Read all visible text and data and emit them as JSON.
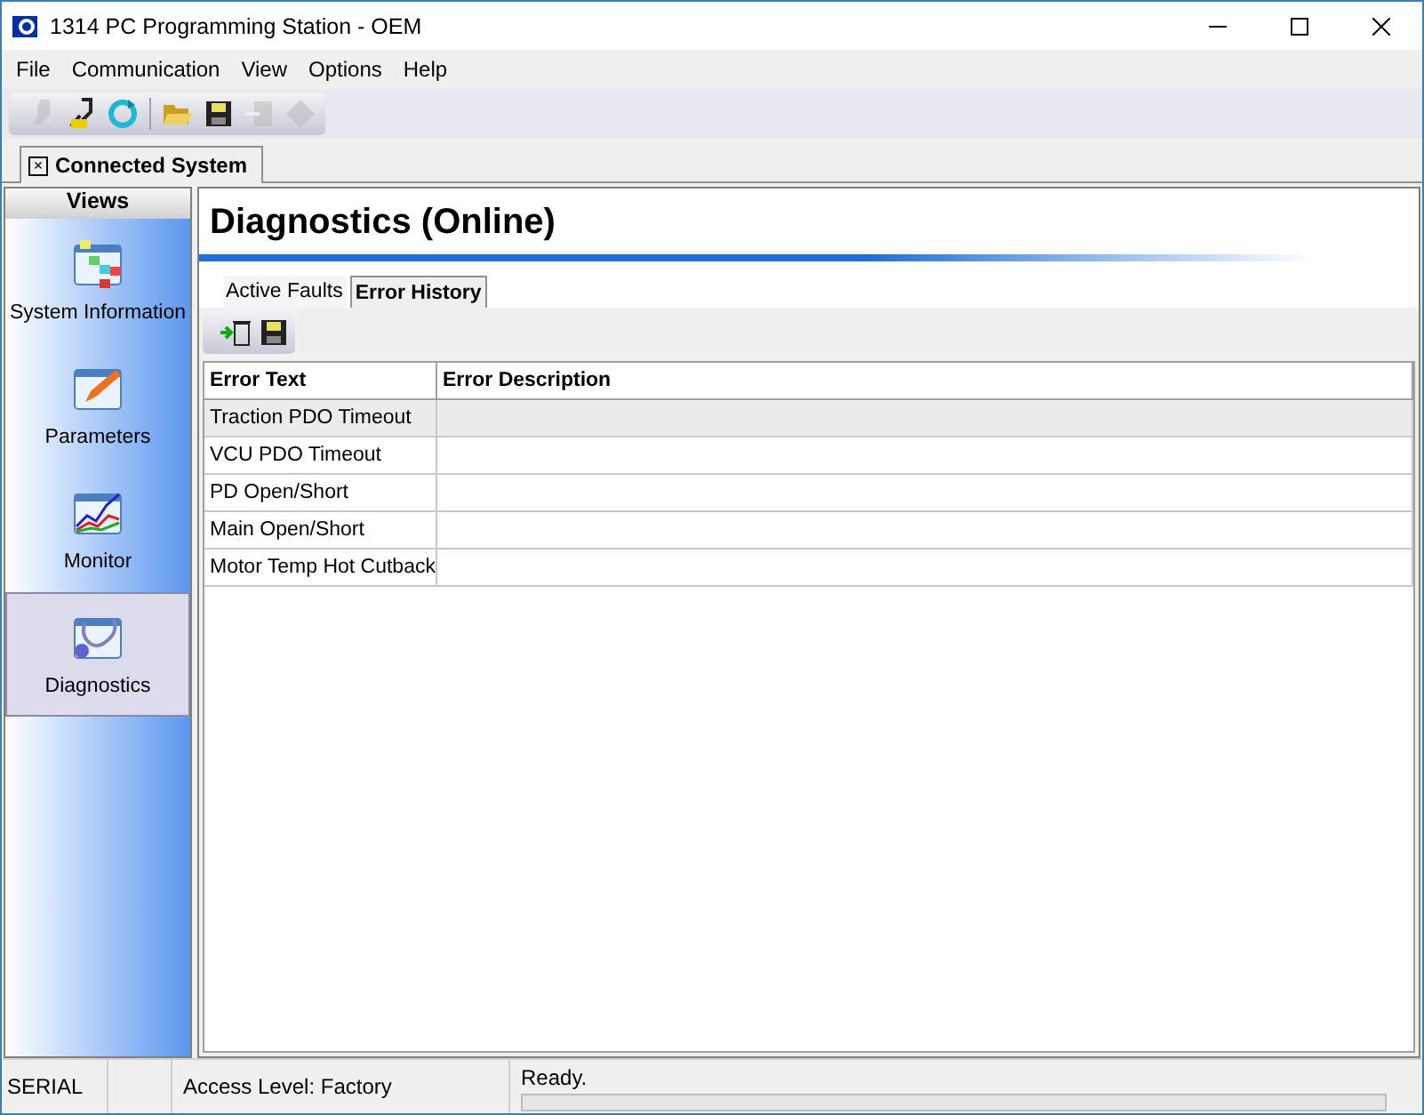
{
  "window": {
    "title": "1314 PC Programming Station - OEM"
  },
  "menu": [
    "File",
    "Communication",
    "View",
    "Options",
    "Help"
  ],
  "toolbar": [
    {
      "kind": "plug",
      "disabled": true
    },
    {
      "kind": "connect",
      "disabled": false
    },
    {
      "kind": "refresh",
      "disabled": false
    },
    {
      "kind": "sep"
    },
    {
      "kind": "open",
      "disabled": false
    },
    {
      "kind": "save",
      "disabled": false
    },
    {
      "kind": "export",
      "disabled": true
    },
    {
      "kind": "stop",
      "disabled": true
    }
  ],
  "doc_tab": {
    "label": "Connected System",
    "close": "×"
  },
  "sidebar": {
    "title": "Views",
    "items": [
      {
        "label": "System Information",
        "kind": "sysinfo",
        "selected": false
      },
      {
        "label": "Parameters",
        "kind": "params",
        "selected": false
      },
      {
        "label": "Monitor",
        "kind": "monitor",
        "selected": false
      },
      {
        "label": "Diagnostics",
        "kind": "diag",
        "selected": true
      }
    ]
  },
  "heading": "Diagnostics (Online)",
  "tabs": [
    {
      "label": "Active Faults",
      "selected": false
    },
    {
      "label": "Error History",
      "selected": true
    }
  ],
  "table": {
    "columns": [
      "Error Text",
      "Error Description"
    ],
    "rows": [
      {
        "text": "Traction PDO Timeout",
        "selected": true
      },
      {
        "text": "VCU PDO Timeout",
        "selected": false
      },
      {
        "text": "PD Open/Short",
        "selected": false
      },
      {
        "text": "Main Open/Short",
        "selected": false
      },
      {
        "text": "Motor Temp Hot Cutback",
        "selected": false
      }
    ]
  },
  "status_bar": {
    "port": "SERIAL",
    "access": "Access Level: Factory",
    "message": "Ready.",
    "level": 0
  }
}
